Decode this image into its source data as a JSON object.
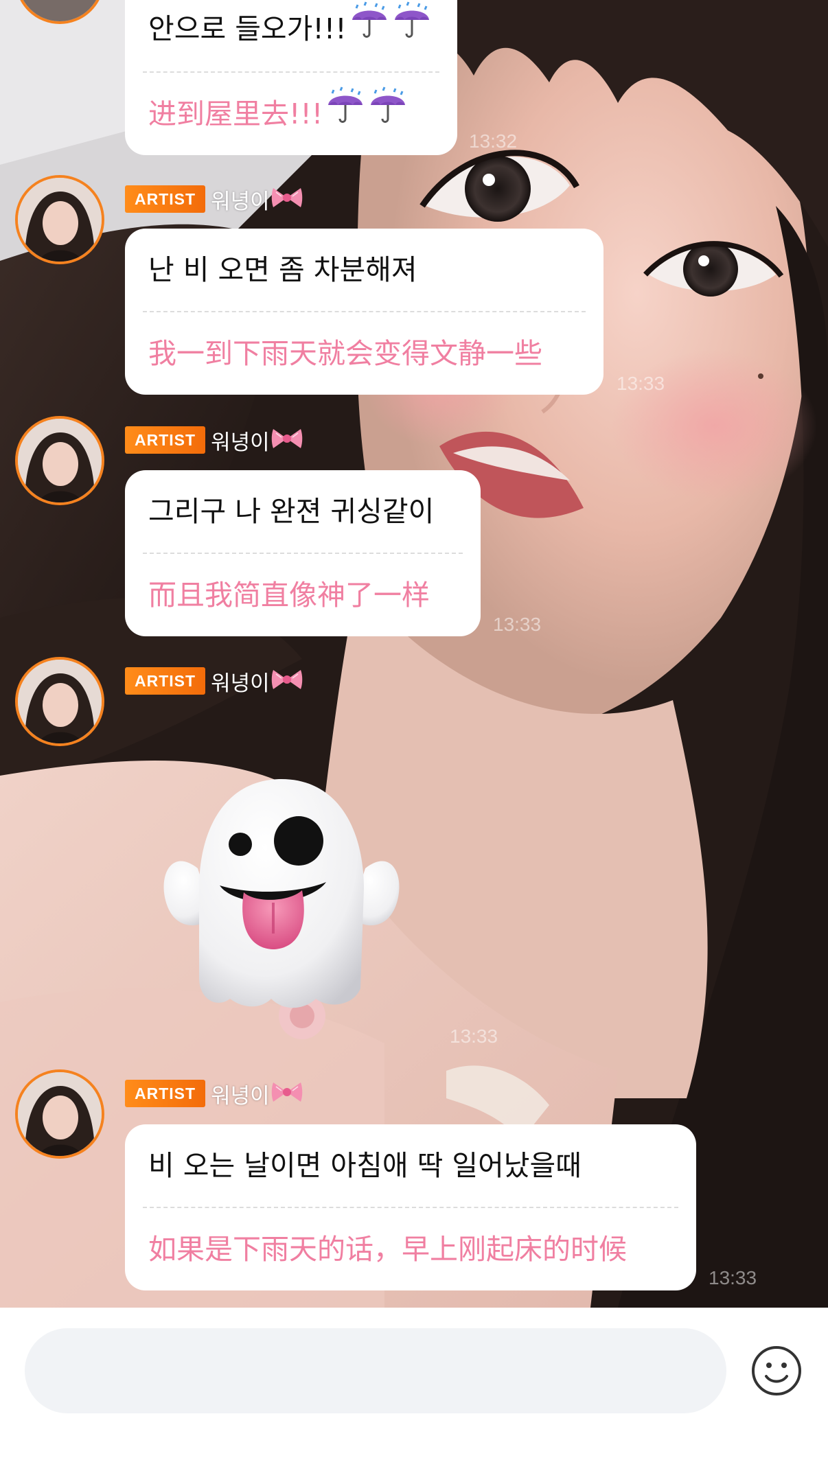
{
  "messages": [
    {
      "original": "안으로 들오가!!!",
      "translation": "进到屋里去!!!",
      "time": "13:32"
    },
    {
      "badge": "ARTIST",
      "sender": "워녕이",
      "original": "난 비 오면 좀 차분해져",
      "translation": "我一到下雨天就会变得文静一些",
      "time": "13:33"
    },
    {
      "badge": "ARTIST",
      "sender": "워녕이",
      "original": "그리구 나 완젼 귀싱같이",
      "translation": "而且我简直像神了一样",
      "time": "13:33"
    },
    {
      "badge": "ARTIST",
      "sender": "워녕이",
      "sticker": "ghost-emoji",
      "time": "13:33"
    },
    {
      "badge": "ARTIST",
      "sender": "워녕이",
      "original": "비 오는 날이면 아침애 딱 일어났을때",
      "translation": "如果是下雨天的话，早上刚起床的时候",
      "time": "13:33"
    }
  ],
  "icons": {
    "bow": "ribbon-bow-icon",
    "umbrella": "umbrella-with-rain-icon",
    "emoji_button": "smiley-face-icon"
  },
  "colors": {
    "badge": "#f36c0a",
    "avatar_ring": "#f5821f",
    "translation_text": "#f07fa1",
    "input_bg": "#f1f3f6"
  },
  "input": {
    "value": "",
    "placeholder": ""
  }
}
